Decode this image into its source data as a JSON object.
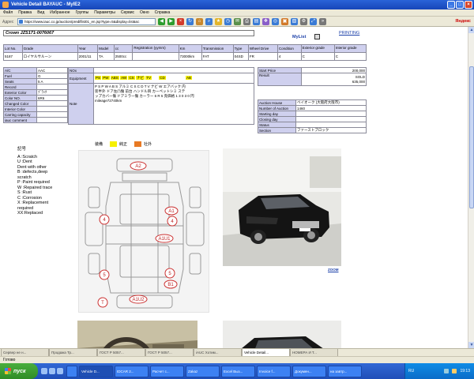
{
  "window": {
    "title": "Vehicle Detail BAYAUC - MyIE2"
  },
  "menu": [
    "Файл",
    "Правка",
    "Вид",
    "Избранное",
    "Группы",
    "Параметры",
    "Сервис",
    "Окно",
    "Справка"
  ],
  "address": {
    "label": "Адрес",
    "url": "https://www.iauc.co.jp/auction/prediflist01_en.jsp?type=5&display=list&sc"
  },
  "yandex": "Яндекс",
  "page": {
    "title": "Crown JZS171-0076067",
    "mylist": "MyList",
    "printing": "PRINTING",
    "lot_headers": [
      "Lot No.",
      "Grade",
      "Year",
      "Model",
      "cc",
      "Registration (yymm)",
      "Km",
      "Transmission",
      "Type",
      "Wheel Drive",
      "Condition",
      "Exterior grade",
      "Interior grade"
    ],
    "lot_values": [
      "5187",
      "ロイヤルサルーン",
      "2001/11",
      "TA",
      "",
      "2500cc",
      "",
      "73000km",
      "FAT",
      "04SD",
      "FR",
      "4",
      "C"
    ],
    "left_labels": [
      "A/C",
      "Fuel",
      "Seats",
      "Record",
      "Exterior Color",
      "Color NO.",
      "Changed Color",
      "Interior Color",
      "Carring capacity",
      "iauc comment"
    ],
    "left_values": [
      "AAC",
      "G",
      "5 A",
      "",
      "ﾌﾞﾗｯｸ",
      "6R6",
      "",
      "",
      "",
      ""
    ],
    "nox_label": "NOx",
    "equipment_label": "Equipment",
    "equipment_tags": [
      "PS",
      "PW",
      "ABS",
      "AW",
      "CS",
      "ナビ",
      "TV",
      "CD",
      "AB"
    ],
    "note_label": "Note",
    "note_lines": [
      "P S   P W   A B S   アルミ   C S   C D   T V   ナビ   W エアバック   内",
      "装半外   ドア左凸傷   前台   ハンドル目   カーペットシミ   ステ",
      "ップカバー傷   ドアミラー傷   カーラー 6 R 5   売価格 1 3 0 3 0 円",
      "mileage72740km"
    ],
    "price_labels": [
      "Start Price",
      "Result"
    ],
    "price_values": [
      "200,000",
      "SOLD\n635,000"
    ],
    "auction_labels": [
      "Auction House",
      "Number of Auction",
      "Starting day",
      "Closing day",
      "Status",
      "Section"
    ],
    "auction_values": [
      "ベイオーク (大阪府大阪市)",
      "1460",
      "",
      "",
      "",
      "ファーストブロック"
    ],
    "legend": {
      "label": "装備",
      "standard": "純正",
      "aftermarket": "社外",
      "standard_color": "#f6f000",
      "aftermarket_color": "#e87a24"
    },
    "codes_title": "記号",
    "codes": [
      "A :Scratch",
      "U :Dent",
      "    Dent with other",
      "B :defects,deep",
      "    scratch",
      "P :Paint required",
      "W :Repaired trace",
      "S :Rust",
      "C :Corrosion",
      "X :Replacement",
      "    required",
      "XX:Replaced"
    ],
    "damage_marks": [
      "A2",
      "A1",
      "4",
      "4",
      "A1U1",
      "5",
      "5",
      "B1",
      "A1U2",
      "T"
    ],
    "zoom": "ZOOM"
  },
  "tabs": [
    "Сервер не н...",
    "Продажа Тр...",
    "ГОСТ Р 5057...",
    "ГОСТ Р 5057...",
    "iAUC Хотим...",
    "Vehicle Detail...",
    "НОМЕРА И Т..."
  ],
  "status": {
    "text": "Готово",
    "zone": ""
  },
  "taskbar": {
    "start": "пуск",
    "items": [
      "",
      "Vehicle D...",
      "IDCAR 2...",
      "Расчет с...",
      "Zakaz",
      "Excel Выз...",
      "Invoice f...",
      "Докумен...",
      "на завтр..."
    ],
    "lang": "RU",
    "clock": "19:13"
  }
}
